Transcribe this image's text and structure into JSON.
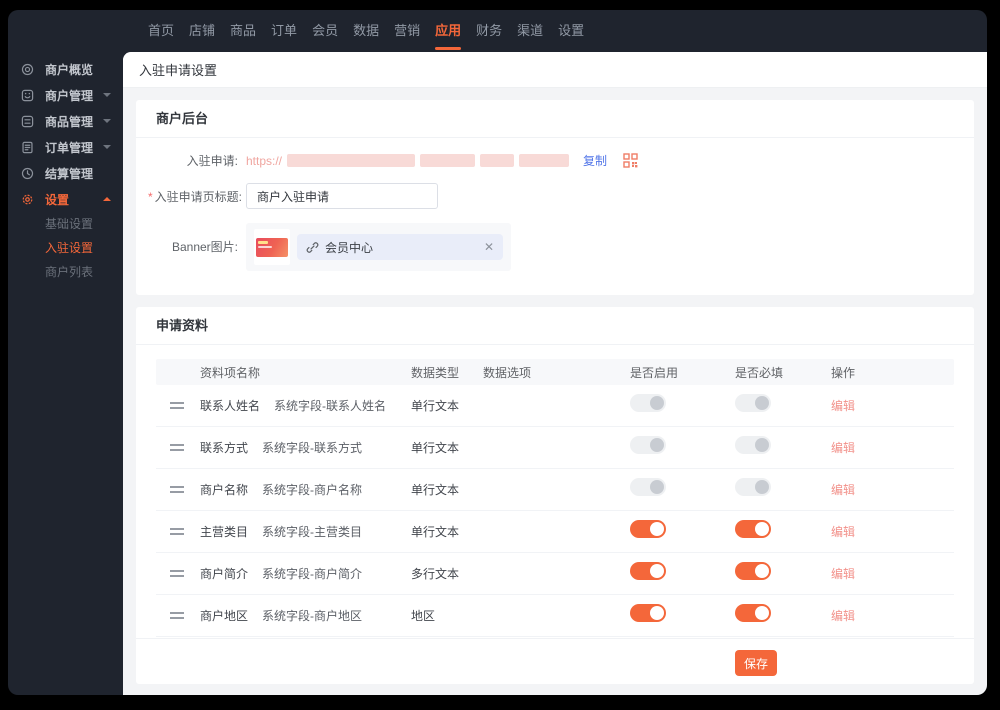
{
  "colors": {
    "accent": "#f4673a",
    "danger_link": "#f2918a",
    "copy_link": "#5276e8",
    "dark_bg": "#1f242e"
  },
  "topnav": {
    "items": [
      {
        "label": "首页",
        "active": false
      },
      {
        "label": "店铺",
        "active": false
      },
      {
        "label": "商品",
        "active": false
      },
      {
        "label": "订单",
        "active": false
      },
      {
        "label": "会员",
        "active": false
      },
      {
        "label": "数据",
        "active": false
      },
      {
        "label": "营销",
        "active": false
      },
      {
        "label": "应用",
        "active": true
      },
      {
        "label": "财务",
        "active": false
      },
      {
        "label": "渠道",
        "active": false
      },
      {
        "label": "设置",
        "active": false
      }
    ]
  },
  "sidebar": {
    "items": [
      {
        "icon": "overview-icon",
        "label": "商户概览",
        "chevron": "",
        "active": false,
        "children": []
      },
      {
        "icon": "merchant-icon",
        "label": "商户管理",
        "chevron": "down",
        "active": false,
        "children": []
      },
      {
        "icon": "product-icon",
        "label": "商品管理",
        "chevron": "down",
        "active": false,
        "children": []
      },
      {
        "icon": "order-icon",
        "label": "订单管理",
        "chevron": "down",
        "active": false,
        "children": []
      },
      {
        "icon": "settlement-icon",
        "label": "结算管理",
        "chevron": "",
        "active": false,
        "children": []
      },
      {
        "icon": "settings-icon",
        "label": "设置",
        "chevron": "up",
        "active": true,
        "children": [
          {
            "label": "基础设置",
            "active": false
          },
          {
            "label": "入驻设置",
            "active": true
          },
          {
            "label": "商户列表",
            "active": false
          }
        ]
      }
    ]
  },
  "page": {
    "title": "入驻申请设置"
  },
  "merchant_backend": {
    "section_title": "商户后台",
    "apply_link_label": "入驻申请:",
    "apply_link_prefix": "https://",
    "apply_link_redacted": true,
    "copy_label": "复制",
    "qr_icon": "qr-code-icon",
    "title_field_label": "入驻申请页标题:",
    "title_field_value": "商户入驻申请",
    "banner_label": "Banner图片:",
    "banner_link_text": "会员中心",
    "banner_remove_icon": "close-icon"
  },
  "apply_form": {
    "section_title": "申请资料",
    "table": {
      "headers": [
        "资料项名称",
        "数据类型",
        "数据选项",
        "是否启用",
        "是否必填",
        "操作"
      ],
      "rows": [
        {
          "name": "联系人姓名",
          "sys": "系统字段-联系人姓名",
          "type": "单行文本",
          "options": "",
          "enabled": false,
          "required": false,
          "action": "编辑"
        },
        {
          "name": "联系方式",
          "sys": "系统字段-联系方式",
          "type": "单行文本",
          "options": "",
          "enabled": false,
          "required": false,
          "action": "编辑"
        },
        {
          "name": "商户名称",
          "sys": "系统字段-商户名称",
          "type": "单行文本",
          "options": "",
          "enabled": false,
          "required": false,
          "action": "编辑"
        },
        {
          "name": "主营类目",
          "sys": "系统字段-主营类目",
          "type": "单行文本",
          "options": "",
          "enabled": true,
          "required": true,
          "action": "编辑"
        },
        {
          "name": "商户简介",
          "sys": "系统字段-商户简介",
          "type": "多行文本",
          "options": "",
          "enabled": true,
          "required": true,
          "action": "编辑"
        },
        {
          "name": "商户地区",
          "sys": "系统字段-商户地区",
          "type": "地区",
          "options": "",
          "enabled": true,
          "required": true,
          "action": "编辑"
        }
      ]
    },
    "save_label": "保存"
  }
}
